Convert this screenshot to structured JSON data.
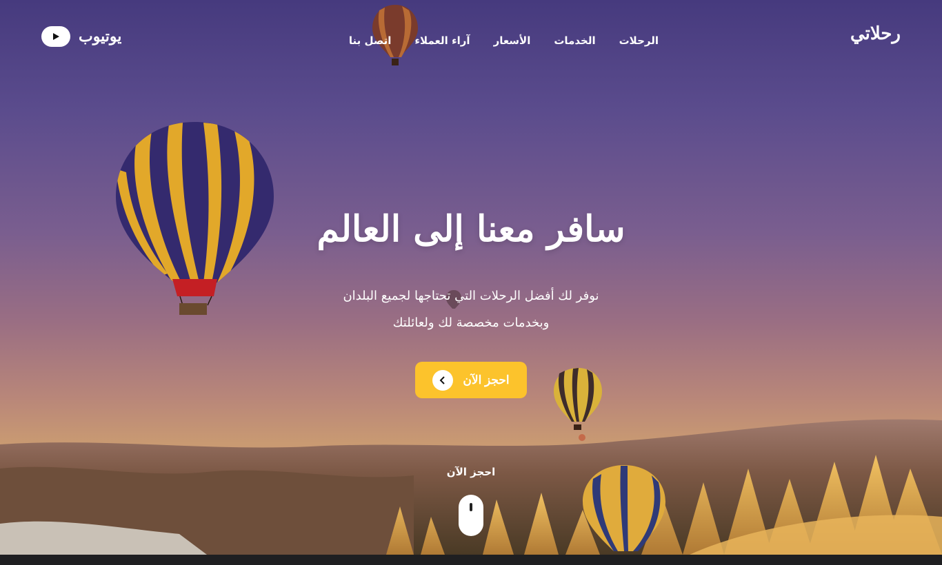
{
  "header": {
    "brand": "رحلاتي",
    "nav": [
      "الرحلات",
      "الخدمات",
      "الأسعار",
      "آراء العملاء",
      "اتصل بنا"
    ],
    "social": {
      "label": "يوتيوب",
      "icon": "youtube-play-icon"
    }
  },
  "hero": {
    "title": "سافر معنا إلى العالم",
    "subtitle_line1": "نوفر لك أفضل الرحلات التي تحتاجها لجميع البلدان",
    "subtitle_line2": "وبخدمات مخصصة لك ولعائلتك",
    "cta_label": "احجز الآن",
    "cta_icon": "chevron-left-icon",
    "scroll_label": "احجز الآن",
    "scroll_icon": "mouse-scroll-icon"
  },
  "colors": {
    "accent": "#fcc32c",
    "sky_top": "#463a7e",
    "footer": "#1f1f21"
  }
}
